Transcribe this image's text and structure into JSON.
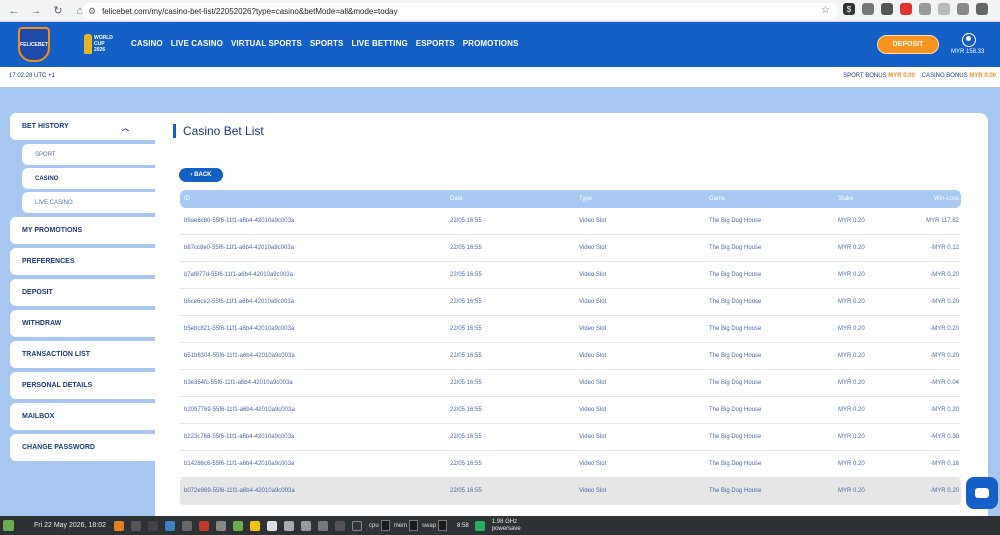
{
  "browser": {
    "url": "felicebet.com/my/casino-bet-list/22052026?type=casino&betMode=all&mode=today"
  },
  "header": {
    "logo_text": "FELICEBET",
    "wc_logo": [
      "WORLD",
      "CUP",
      "2026"
    ],
    "nav": [
      "CASINO",
      "LIVE CASINO",
      "VIRTUAL SPORTS",
      "SPORTS",
      "LIVE BETTING",
      "ESPORTS",
      "PROMOTIONS"
    ],
    "deposit_label": "DEPOSIT",
    "balance": "MYR 158.33"
  },
  "info": {
    "time": "17:02:28 UTC +1",
    "sport_bonus_label": "SPORT BONUS",
    "sport_bonus_value": "MYR 0.00",
    "casino_bonus_label": "CASINO BONUS",
    "casino_bonus_value": "MYR 0.00"
  },
  "sidebar": {
    "bet_history": "BET HISTORY",
    "sub": [
      "SPORT",
      "CASINO",
      "LIVE CASINO"
    ],
    "items": [
      "MY PROMOTIONS",
      "PREFERENCES",
      "DEPOSIT",
      "WITHDRAW",
      "TRANSACTION LIST",
      "PERSONAL DETAILS",
      "MAILBOX",
      "CHANGE PASSWORD"
    ]
  },
  "main": {
    "title": "Casino Bet List",
    "back_label": "BACK",
    "columns": [
      "ID",
      "Date",
      "Type",
      "Game",
      "Stake",
      "Win-Loss"
    ],
    "rows": [
      [
        "b9ae6c80-55f6-11f1-a6b4-42010a9c003a",
        "22/05 16:55",
        "Video Slot",
        "The Big Dog House",
        "MYR 0.20",
        "MYR 117.82"
      ],
      [
        "b87cc8e0-55f6-11f1-a6b4-42010a9c003a",
        "22/05 16:55",
        "Video Slot",
        "The Big Dog House",
        "MYR 0.20",
        "-MYR 0.12"
      ],
      [
        "b7af877d-55f6-11f1-a6b4-42010a9c003a",
        "22/05 16:55",
        "Video Slot",
        "The Big Dog House",
        "MYR 0.20",
        "-MYR 0.20"
      ],
      [
        "b6ce6ce2-55f6-11f1-a6b4-42010a9c003a",
        "22/05 16:55",
        "Video Slot",
        "The Big Dog House",
        "MYR 0.20",
        "-MYR 0.20"
      ],
      [
        "b5ebc821-55f6-11f1-a6b4-42010a9c003a",
        "22/05 16:55",
        "Video Slot",
        "The Big Dog House",
        "MYR 0.20",
        "-MYR 0.20"
      ],
      [
        "b51b6304-55f6-11f1-a6b4-42010a9c003a",
        "22/05 16:55",
        "Video Slot",
        "The Big Dog House",
        "MYR 0.20",
        "-MYR 0.20"
      ],
      [
        "b3e354fc-55f6-11f1-a6b4-42010a9c003a",
        "22/05 16:55",
        "Video Slot",
        "The Big Dog House",
        "MYR 0.20",
        "-MYR 0.04"
      ],
      [
        "b2097769-55f6-11f1-a6b4-42010a9c003a",
        "22/05 16:55",
        "Video Slot",
        "The Big Dog House",
        "MYR 0.20",
        "-MYR 0.20"
      ],
      [
        "b223c768-55f6-11f1-a6b4-42010a9c003a",
        "22/05 16:55",
        "Video Slot",
        "The Big Dog House",
        "MYR 0.20",
        "-MYR 0.30"
      ],
      [
        "b14286c6-55f6-11f1-a6b4-42010a9c003a",
        "22/05 16:55",
        "Video Slot",
        "The Big Dog House",
        "MYR 0.20",
        "-MYR 0.18"
      ],
      [
        "b072e969-55f6-11f1-a6b4-42010a9c003a",
        "22/05 16:55",
        "Video Slot",
        "The Big Dog House",
        "MYR 0.20",
        "-MYR 0.20"
      ]
    ]
  },
  "taskbar": {
    "date": "Fri 22 May 2026, 18:02",
    "cpu": "cpu",
    "mem": "mem",
    "swap": "swap",
    "clock": "8:58",
    "freq_1": "1.98 GHz",
    "freq_2": "powersave"
  },
  "colors": {
    "brand_blue": "#1560c7",
    "accent_orange": "#f7931e",
    "page_bg": "#a7c6f0"
  }
}
